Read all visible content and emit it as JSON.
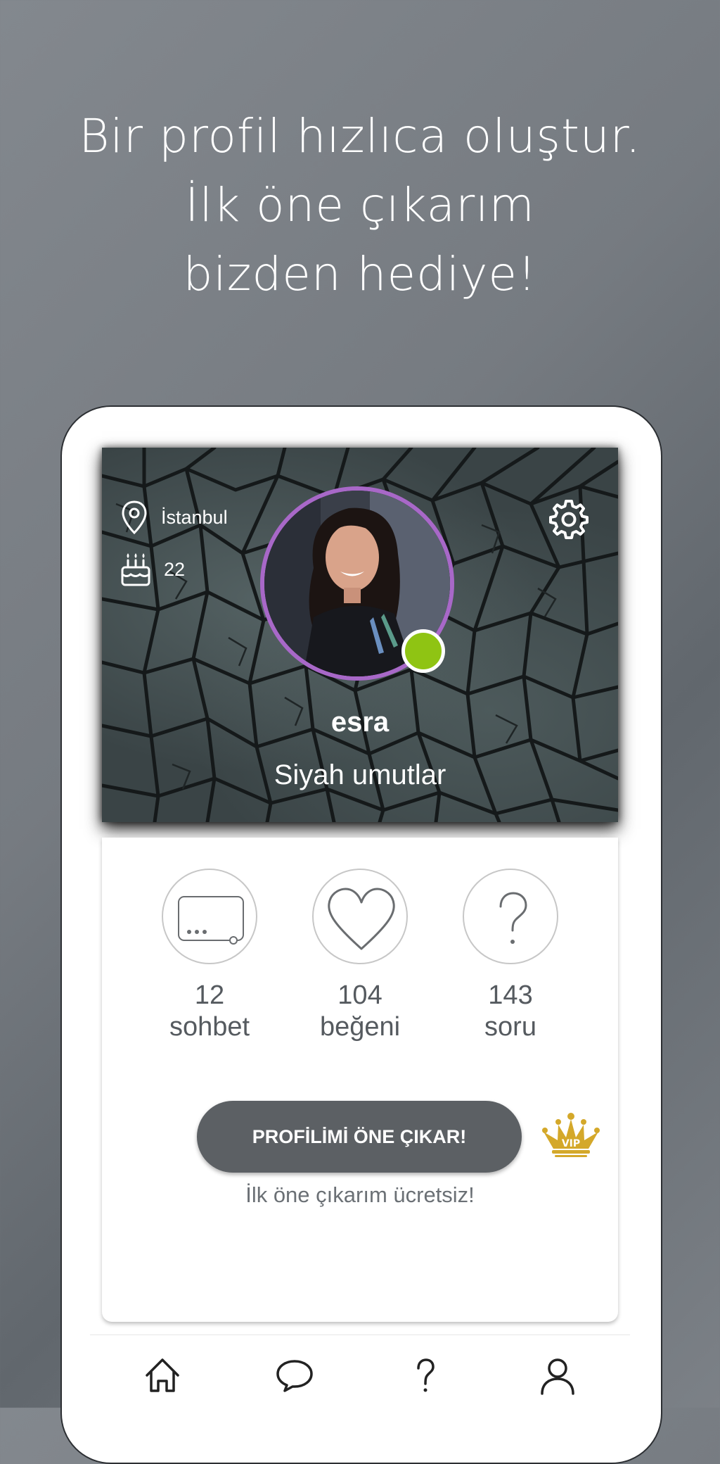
{
  "headline": {
    "line1": "Bir profil hızlıca oluştur.",
    "line2": "İlk öne çıkarım",
    "line3": "bizden hediye!"
  },
  "profile": {
    "location": "İstanbul",
    "age": "22",
    "name": "esra",
    "status": "Siyah umutlar",
    "online": true
  },
  "stats": [
    {
      "count": "12",
      "label": "sohbet",
      "icon": "chat-box-icon"
    },
    {
      "count": "104",
      "label": "beğeni",
      "icon": "heart-icon"
    },
    {
      "count": "143",
      "label": "soru",
      "icon": "question-icon"
    }
  ],
  "boost": {
    "button_label": "PROFİLİMİ ÖNE ÇIKAR!",
    "note": "İlk öne çıkarım ücretsiz!",
    "badge_text": "VIP"
  },
  "bottom_nav": [
    {
      "icon": "home-icon"
    },
    {
      "icon": "chat-bubble-icon"
    },
    {
      "icon": "question-icon"
    },
    {
      "icon": "profile-icon"
    }
  ],
  "colors": {
    "accent_ring": "#a868c8",
    "online": "#8fc413",
    "button": "#5c6064",
    "vip_gold": "#d4a82a"
  }
}
